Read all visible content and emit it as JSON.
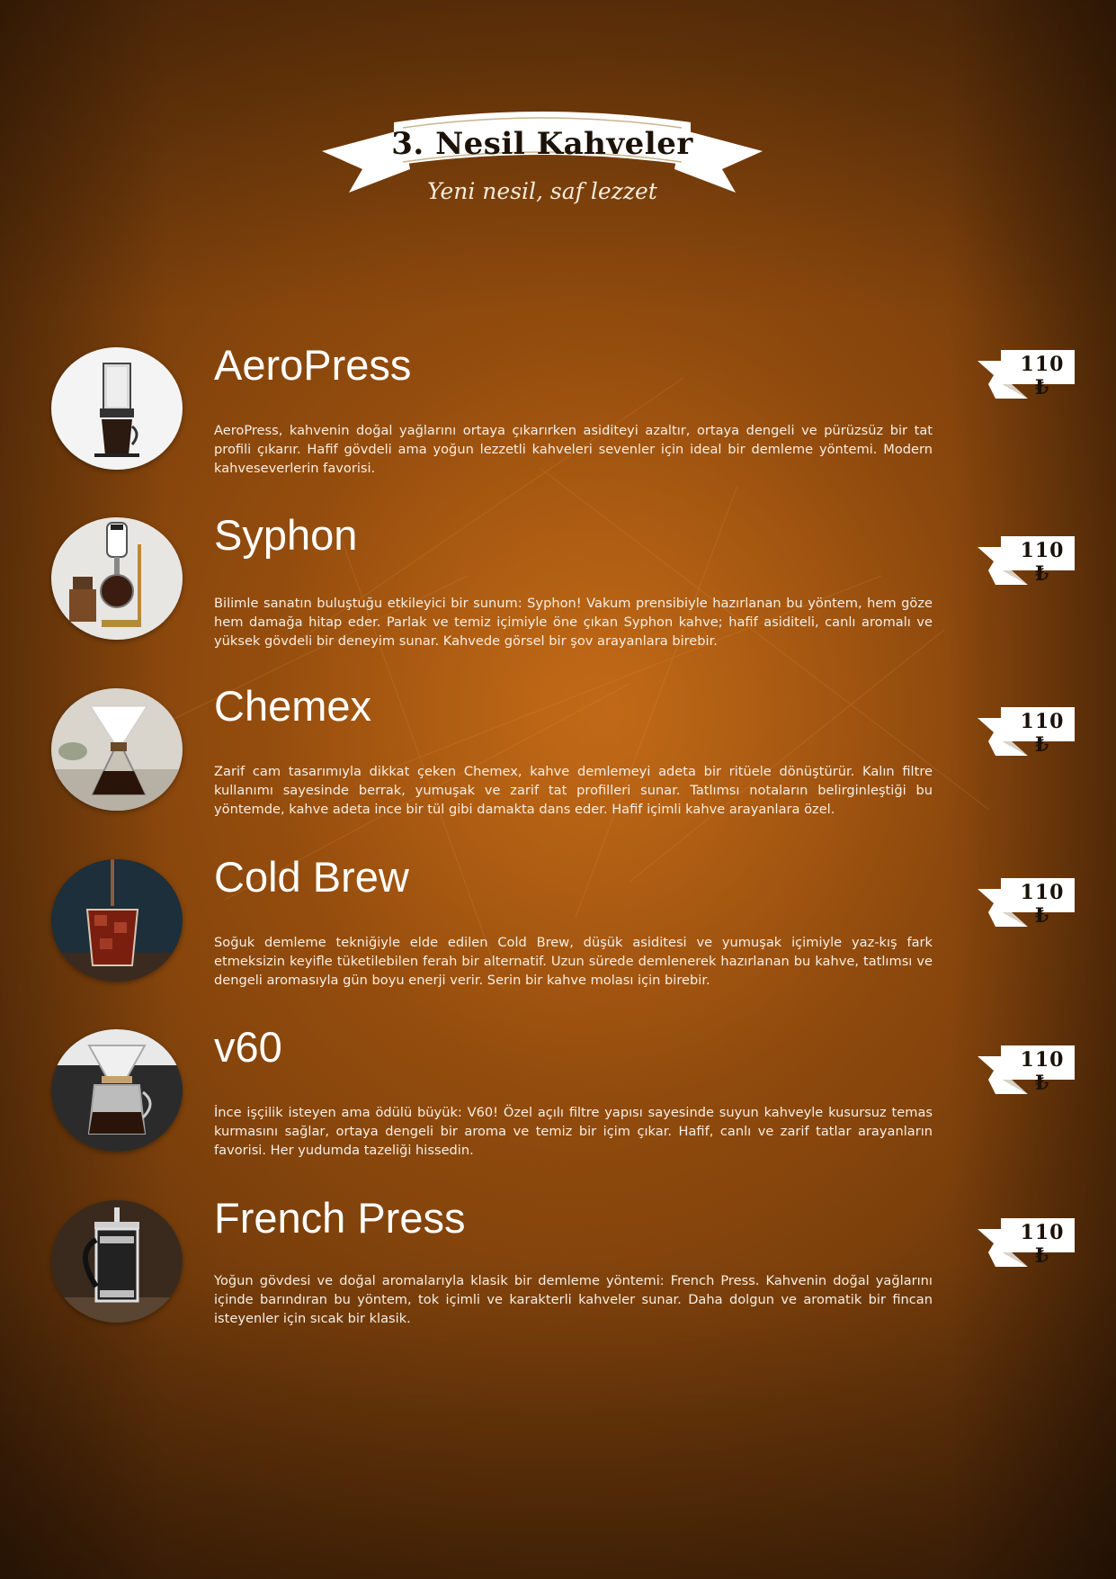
{
  "header": {
    "title": "3. Nesil Kahveler",
    "subtitle": "Yeni nesil, saf lezzet"
  },
  "colors": {
    "background": "#8a4a0e",
    "text": "#ffffff",
    "banner": "#ffffff",
    "banner_text": "#1c1208"
  },
  "items": [
    {
      "name": "AeroPress",
      "price": "110 ₺",
      "icon": "aeropress-photo",
      "description": "AeroPress, kahvenin doğal yağlarını ortaya çıkarırken asiditeyi azaltır, ortaya dengeli ve pürüzsüz bir tat profili çıkarır. Hafif gövdeli ama yoğun lezzetli kahveleri sevenler için ideal bir demleme yöntemi. Modern kahveseverlerin favorisi."
    },
    {
      "name": "Syphon",
      "price": "110 ₺",
      "icon": "syphon-photo",
      "description": "Bilimle sanatın buluştuğu etkileyici bir sunum: Syphon! Vakum prensibiyle hazırlanan bu yöntem, hem göze hem damağa hitap eder. Parlak ve temiz içimiyle öne çıkan Syphon kahve; hafif asiditeli, canlı aromalı ve yüksek gövdeli bir deneyim sunar. Kahvede görsel bir şov arayanlara birebir."
    },
    {
      "name": "Chemex",
      "price": "110 ₺",
      "icon": "chemex-photo",
      "description": "Zarif cam tasarımıyla dikkat çeken Chemex, kahve demlemeyi adeta bir ritüele dönüştürür. Kalın filtre kullanımı sayesinde berrak, yumuşak ve zarif tat profilleri sunar. Tatlımsı notaların belirginleştiği bu yöntemde, kahve adeta ince bir tül gibi damakta dans eder. Hafif içimli kahve arayanlara özel."
    },
    {
      "name": "Cold Brew",
      "price": "110 ₺",
      "icon": "cold-brew-photo",
      "description": "Soğuk demleme tekniğiyle elde edilen Cold Brew, düşük asiditesi ve yumuşak içimiyle yaz-kış fark etmeksizin keyifle tüketilebilen ferah bir alternatif. Uzun sürede demlenerek hazırlanan bu kahve, tatlımsı ve dengeli aromasıyla gün boyu enerji verir. Serin bir kahve molası için birebir."
    },
    {
      "name": "v60",
      "price": "110 ₺",
      "icon": "v60-photo",
      "description": "İnce işçilik isteyen ama ödülü büyük: V60! Özel açılı filtre yapısı sayesinde suyun kahveyle kusursuz temas kurmasını sağlar, ortaya dengeli bir aroma ve temiz bir içim çıkar. Hafif, canlı ve zarif tatlar arayanların favorisi. Her yudumda tazeliği hissedin."
    },
    {
      "name": "French Press",
      "price": "110 ₺",
      "icon": "french-press-photo",
      "description": "Yoğun gövdesi ve doğal aromalarıyla klasik bir demleme yöntemi: French Press. Kahvenin doğal yağlarını içinde barındıran bu yöntem, tok içimli ve karakterli kahveler sunar. Daha dolgun ve aromatik bir fincan isteyenler için sıcak bir klasik."
    }
  ]
}
